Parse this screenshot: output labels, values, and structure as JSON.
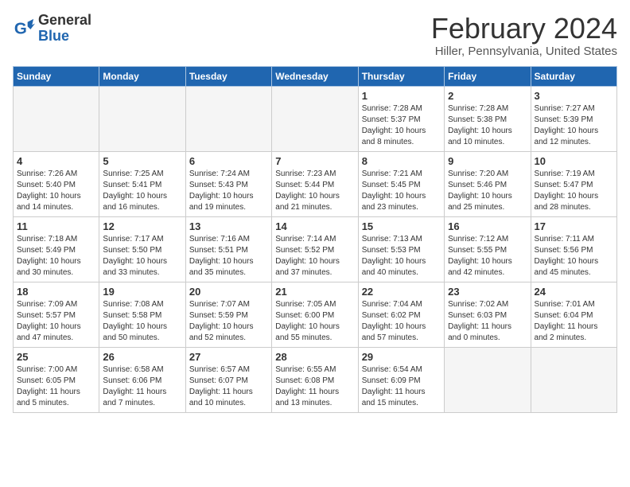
{
  "header": {
    "logo_general": "General",
    "logo_blue": "Blue",
    "title": "February 2024",
    "subtitle": "Hiller, Pennsylvania, United States"
  },
  "days_of_week": [
    "Sunday",
    "Monday",
    "Tuesday",
    "Wednesday",
    "Thursday",
    "Friday",
    "Saturday"
  ],
  "weeks": [
    [
      {
        "day": "",
        "info": ""
      },
      {
        "day": "",
        "info": ""
      },
      {
        "day": "",
        "info": ""
      },
      {
        "day": "",
        "info": ""
      },
      {
        "day": "1",
        "info": "Sunrise: 7:28 AM\nSunset: 5:37 PM\nDaylight: 10 hours\nand 8 minutes."
      },
      {
        "day": "2",
        "info": "Sunrise: 7:28 AM\nSunset: 5:38 PM\nDaylight: 10 hours\nand 10 minutes."
      },
      {
        "day": "3",
        "info": "Sunrise: 7:27 AM\nSunset: 5:39 PM\nDaylight: 10 hours\nand 12 minutes."
      }
    ],
    [
      {
        "day": "4",
        "info": "Sunrise: 7:26 AM\nSunset: 5:40 PM\nDaylight: 10 hours\nand 14 minutes."
      },
      {
        "day": "5",
        "info": "Sunrise: 7:25 AM\nSunset: 5:41 PM\nDaylight: 10 hours\nand 16 minutes."
      },
      {
        "day": "6",
        "info": "Sunrise: 7:24 AM\nSunset: 5:43 PM\nDaylight: 10 hours\nand 19 minutes."
      },
      {
        "day": "7",
        "info": "Sunrise: 7:23 AM\nSunset: 5:44 PM\nDaylight: 10 hours\nand 21 minutes."
      },
      {
        "day": "8",
        "info": "Sunrise: 7:21 AM\nSunset: 5:45 PM\nDaylight: 10 hours\nand 23 minutes."
      },
      {
        "day": "9",
        "info": "Sunrise: 7:20 AM\nSunset: 5:46 PM\nDaylight: 10 hours\nand 25 minutes."
      },
      {
        "day": "10",
        "info": "Sunrise: 7:19 AM\nSunset: 5:47 PM\nDaylight: 10 hours\nand 28 minutes."
      }
    ],
    [
      {
        "day": "11",
        "info": "Sunrise: 7:18 AM\nSunset: 5:49 PM\nDaylight: 10 hours\nand 30 minutes."
      },
      {
        "day": "12",
        "info": "Sunrise: 7:17 AM\nSunset: 5:50 PM\nDaylight: 10 hours\nand 33 minutes."
      },
      {
        "day": "13",
        "info": "Sunrise: 7:16 AM\nSunset: 5:51 PM\nDaylight: 10 hours\nand 35 minutes."
      },
      {
        "day": "14",
        "info": "Sunrise: 7:14 AM\nSunset: 5:52 PM\nDaylight: 10 hours\nand 37 minutes."
      },
      {
        "day": "15",
        "info": "Sunrise: 7:13 AM\nSunset: 5:53 PM\nDaylight: 10 hours\nand 40 minutes."
      },
      {
        "day": "16",
        "info": "Sunrise: 7:12 AM\nSunset: 5:55 PM\nDaylight: 10 hours\nand 42 minutes."
      },
      {
        "day": "17",
        "info": "Sunrise: 7:11 AM\nSunset: 5:56 PM\nDaylight: 10 hours\nand 45 minutes."
      }
    ],
    [
      {
        "day": "18",
        "info": "Sunrise: 7:09 AM\nSunset: 5:57 PM\nDaylight: 10 hours\nand 47 minutes."
      },
      {
        "day": "19",
        "info": "Sunrise: 7:08 AM\nSunset: 5:58 PM\nDaylight: 10 hours\nand 50 minutes."
      },
      {
        "day": "20",
        "info": "Sunrise: 7:07 AM\nSunset: 5:59 PM\nDaylight: 10 hours\nand 52 minutes."
      },
      {
        "day": "21",
        "info": "Sunrise: 7:05 AM\nSunset: 6:00 PM\nDaylight: 10 hours\nand 55 minutes."
      },
      {
        "day": "22",
        "info": "Sunrise: 7:04 AM\nSunset: 6:02 PM\nDaylight: 10 hours\nand 57 minutes."
      },
      {
        "day": "23",
        "info": "Sunrise: 7:02 AM\nSunset: 6:03 PM\nDaylight: 11 hours\nand 0 minutes."
      },
      {
        "day": "24",
        "info": "Sunrise: 7:01 AM\nSunset: 6:04 PM\nDaylight: 11 hours\nand 2 minutes."
      }
    ],
    [
      {
        "day": "25",
        "info": "Sunrise: 7:00 AM\nSunset: 6:05 PM\nDaylight: 11 hours\nand 5 minutes."
      },
      {
        "day": "26",
        "info": "Sunrise: 6:58 AM\nSunset: 6:06 PM\nDaylight: 11 hours\nand 7 minutes."
      },
      {
        "day": "27",
        "info": "Sunrise: 6:57 AM\nSunset: 6:07 PM\nDaylight: 11 hours\nand 10 minutes."
      },
      {
        "day": "28",
        "info": "Sunrise: 6:55 AM\nSunset: 6:08 PM\nDaylight: 11 hours\nand 13 minutes."
      },
      {
        "day": "29",
        "info": "Sunrise: 6:54 AM\nSunset: 6:09 PM\nDaylight: 11 hours\nand 15 minutes."
      },
      {
        "day": "",
        "info": ""
      },
      {
        "day": "",
        "info": ""
      }
    ]
  ]
}
